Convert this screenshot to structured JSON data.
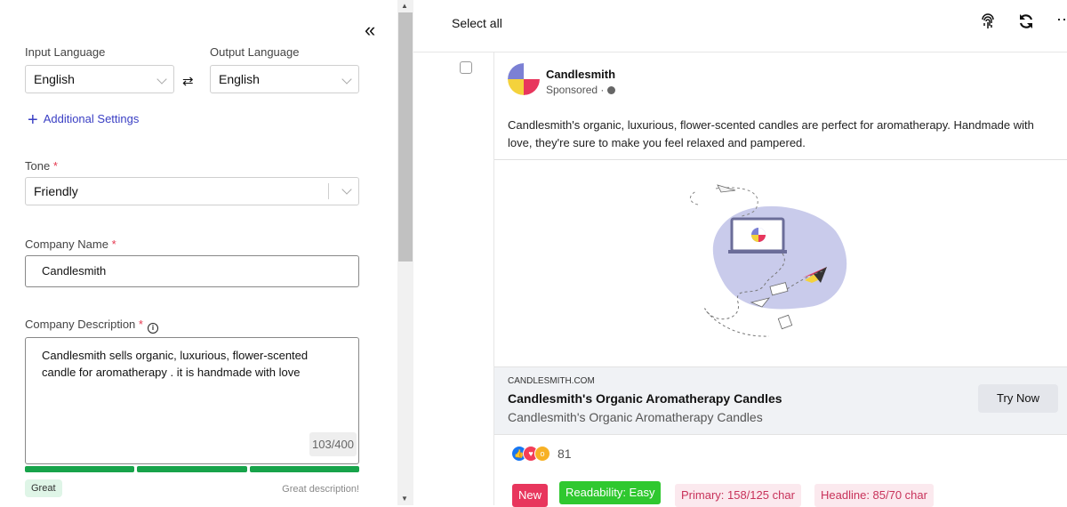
{
  "left": {
    "input_language_label": "Input Language",
    "input_language_value": "English",
    "output_language_label": "Output Language",
    "output_language_value": "English",
    "additional_settings": "Additional Settings",
    "tone_label": "Tone",
    "tone_value": "Friendly",
    "company_name_label": "Company Name",
    "company_name_value": "Candlesmith",
    "company_description_label": "Company Description",
    "company_description_value": "Candlesmith sells organic, luxurious, flower-scented candle for aromatherapy . it is handmade with love",
    "char_counter": "103/400",
    "quality_badge": "Great",
    "quality_text": "Great description!",
    "required_marker": "*"
  },
  "right": {
    "select_all": "Select all",
    "ad": {
      "brand": "Candlesmith",
      "sponsored": "Sponsored ·",
      "primary_text": "Candlesmith's organic, luxurious, flower-scented candles are perfect for aromatherapy. Handmade with love, they're sure to make you feel relaxed and pampered.",
      "domain": "CANDLESMITH.COM",
      "headline": "Candlesmith's Organic Aromatherapy Candles",
      "description": "Candlesmith's Organic Aromatherapy Candles",
      "cta": "Try Now",
      "reaction_count": "81"
    },
    "tags": {
      "new": "New",
      "readability": "Readability: Easy",
      "primary": "Primary: 158/125 char",
      "headline": "Headline: 85/70 char"
    }
  },
  "colors": {
    "accent": "#3a3fc4",
    "required": "#e53950",
    "progress": "#17a34a",
    "new_tag": "#e8365d",
    "readability_tag": "#2fc82f",
    "warn_tag_bg": "#fbe9ee",
    "warn_tag_text": "#c8325a"
  },
  "icons": [
    "collapse-double-chevron-icon",
    "swap-icon",
    "plus-icon",
    "info-icon",
    "fingerprint-icon",
    "refresh-icon",
    "more-icon",
    "globe-icon"
  ]
}
